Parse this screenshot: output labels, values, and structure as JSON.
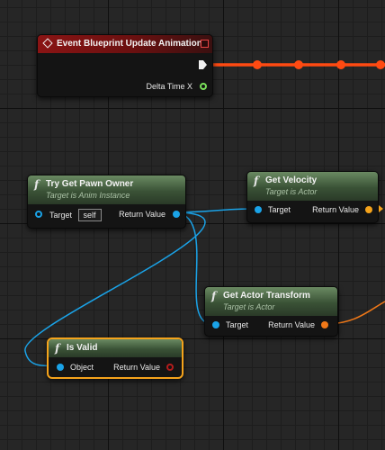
{
  "event_node": {
    "title": "Event Blueprint Update Animation",
    "pin_label": "Delta Time X"
  },
  "try_get_pawn_owner": {
    "title": "Try Get Pawn Owner",
    "subtitle": "Target is Anim Instance",
    "target_label": "Target",
    "target_value": "self",
    "return_label": "Return Value"
  },
  "get_velocity": {
    "title": "Get Velocity",
    "subtitle": "Target is Actor",
    "target_label": "Target",
    "return_label": "Return Value"
  },
  "get_actor_transform": {
    "title": "Get Actor Transform",
    "subtitle": "Target is Actor",
    "target_label": "Target",
    "return_label": "Return Value"
  },
  "is_valid": {
    "title": "Is Valid",
    "object_label": "Object",
    "return_label": "Return Value"
  },
  "function_icon": "f",
  "colors": {
    "exec_wire": "#ff4a12",
    "object_wire": "#1aa3e8",
    "transform_wire": "#f07818",
    "selected_outline": "#f5a31b",
    "event_header": "#8a1414"
  }
}
